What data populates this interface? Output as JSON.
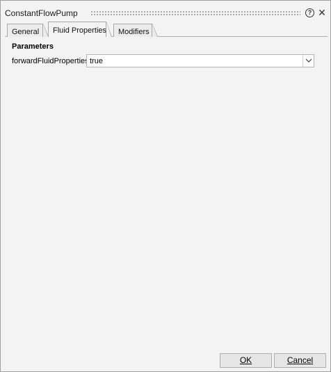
{
  "window": {
    "title": "ConstantFlowPump",
    "help_glyph": "?",
    "close_glyph": "✕"
  },
  "tabs": [
    {
      "label": "General",
      "active": false
    },
    {
      "label": "Fluid Properties",
      "active": true
    },
    {
      "label": "Modifiers",
      "active": false
    }
  ],
  "parameters": {
    "section_title": "Parameters",
    "items": [
      {
        "label": "forwardFluidProperties",
        "value": "true"
      }
    ]
  },
  "footer": {
    "ok_label": "OK",
    "cancel_label": "Cancel"
  },
  "icons": {
    "help": "help-icon",
    "close": "close-icon",
    "dropdown": "chevron-down-icon"
  }
}
